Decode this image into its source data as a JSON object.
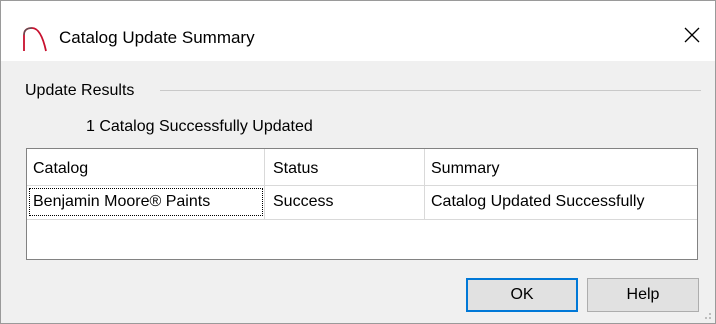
{
  "window": {
    "title": "Catalog Update Summary",
    "icon": "arch-icon",
    "close_glyph": "✕"
  },
  "group": {
    "label": "Update Results",
    "count_text": "1 Catalog Successfully Updated"
  },
  "table": {
    "columns": [
      "Catalog",
      "Status",
      "Summary"
    ],
    "rows": [
      {
        "catalog": "Benjamin Moore® Paints",
        "status": "Success",
        "summary": "Catalog Updated Successfully"
      }
    ]
  },
  "buttons": {
    "ok_label": "OK",
    "help_label": "Help"
  },
  "colors": {
    "accent": "#0078d7",
    "icon_stroke": "#c8102e"
  }
}
